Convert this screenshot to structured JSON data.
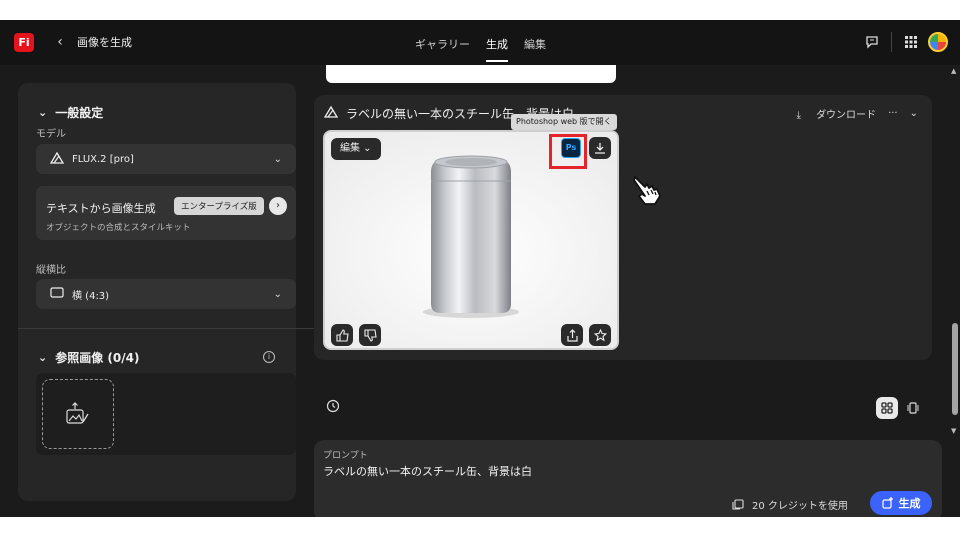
{
  "header": {
    "logo": "Fi",
    "back_icon": "chevron-left-icon",
    "page_title": "画像を生成",
    "nav": [
      {
        "label": "ギャラリー",
        "active": false
      },
      {
        "label": "生成",
        "active": true
      },
      {
        "label": "編集",
        "active": false
      }
    ],
    "icons": [
      "feedback-icon",
      "app-grid-icon",
      "avatar"
    ]
  },
  "sidebar": {
    "general": {
      "title": "一般設定",
      "model_label": "モデル",
      "model_value": "FLUX.2 [pro]",
      "card_title": "テキストから画像生成",
      "card_badge": "エンタープライズ版",
      "card_subtitle": "オブジェクトの合成とスタイルキット",
      "aspect_label": "縦横比",
      "aspect_value": "横 (4:3)"
    },
    "reference": {
      "title": "参照画像 (0/4)"
    }
  },
  "result": {
    "title": "ラベルの無い一本のスチール缶、背景は白",
    "download_label": "ダウンロード",
    "more_label": "···",
    "edit_label": "編集",
    "ps_label": "Ps",
    "tooltip": "Photoshop web 版で開く"
  },
  "prompt": {
    "label": "プロンプト",
    "text": "ラベルの無い一本のスチール缶、背景は白",
    "credits_text": "20 クレジットを使用",
    "generate_label": "生成"
  },
  "colors": {
    "accent": "#3b63fb",
    "highlight": "#e3242b",
    "brand": "#e5131b"
  }
}
